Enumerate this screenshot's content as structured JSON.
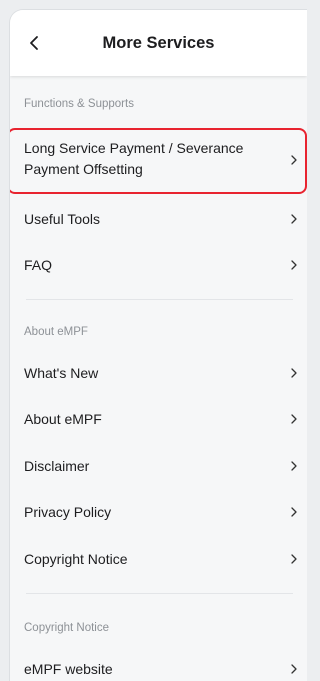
{
  "header": {
    "title": "More Services",
    "back_icon": "chevron-left-icon"
  },
  "sections": [
    {
      "label": "Functions & Supports",
      "items": [
        {
          "label": "Long Service Payment / Severance Payment Offsetting",
          "highlighted": true
        },
        {
          "label": "Useful Tools"
        },
        {
          "label": "FAQ"
        }
      ]
    },
    {
      "label": "About eMPF",
      "items": [
        {
          "label": "What's New"
        },
        {
          "label": "About eMPF"
        },
        {
          "label": "Disclaimer"
        },
        {
          "label": "Privacy Policy"
        },
        {
          "label": "Copyright Notice"
        }
      ]
    },
    {
      "label": "Copyright Notice",
      "items": [
        {
          "label": "eMPF website"
        }
      ]
    }
  ],
  "colors": {
    "highlight": "#e8232f",
    "text": "#1d1d1f",
    "section_label": "#8d9196"
  }
}
